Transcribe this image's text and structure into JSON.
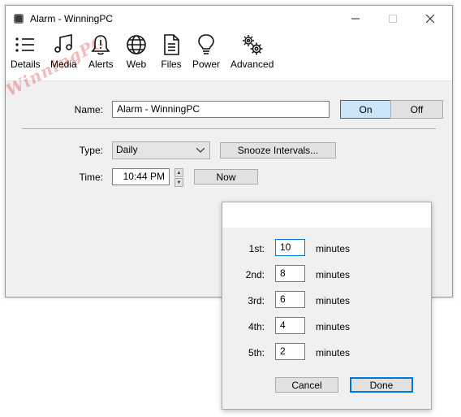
{
  "window": {
    "title": "Alarm - WinningPC"
  },
  "toolbar": {
    "items": [
      {
        "label": "Details",
        "icon": "list-icon"
      },
      {
        "label": "Media",
        "icon": "music-note-icon"
      },
      {
        "label": "Alerts",
        "icon": "bell-icon"
      },
      {
        "label": "Web",
        "icon": "globe-icon"
      },
      {
        "label": "Files",
        "icon": "document-icon"
      },
      {
        "label": "Power",
        "icon": "lightbulb-icon"
      },
      {
        "label": "Advanced",
        "icon": "gears-icon"
      }
    ]
  },
  "watermark": "WinningPC",
  "form": {
    "name_label": "Name:",
    "name_value": "Alarm - WinningPC",
    "on_label": "On",
    "off_label": "Off",
    "type_label": "Type:",
    "type_value": "Daily",
    "snooze_button": "Snooze Intervals...",
    "time_label": "Time:",
    "time_value": "10:44 PM",
    "now_button": "Now"
  },
  "snooze_popup": {
    "rows": [
      {
        "label": "1st:",
        "value": "10",
        "unit": "minutes"
      },
      {
        "label": "2nd:",
        "value": "8",
        "unit": "minutes"
      },
      {
        "label": "3rd:",
        "value": "6",
        "unit": "minutes"
      },
      {
        "label": "4th:",
        "value": "4",
        "unit": "minutes"
      },
      {
        "label": "5th:",
        "value": "2",
        "unit": "minutes"
      }
    ],
    "cancel_label": "Cancel",
    "done_label": "Done"
  },
  "colors": {
    "accent": "#0078d7",
    "toggle_on_bg": "#cce4f7"
  }
}
